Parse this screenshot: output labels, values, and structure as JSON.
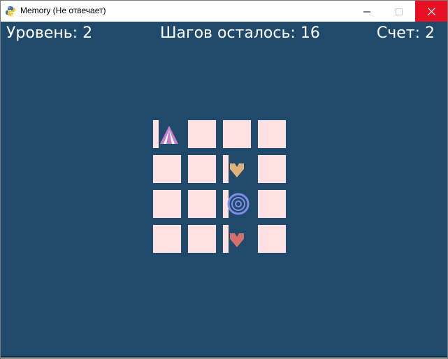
{
  "window": {
    "title": "Memory (Не отвечает)",
    "app_icon": "python-icon",
    "controls": [
      "minimize-icon",
      "maximize-icon",
      "close-icon"
    ],
    "close_color": "#e81123"
  },
  "hud": {
    "level_text": "Уровень: 2",
    "steps_text": "Шагов осталось: 16",
    "score_text": "Счет: 2"
  },
  "board": {
    "rows": 4,
    "cols": 4,
    "background_color": "#1f4a6b",
    "tile_color": "#ffe1e1",
    "revealed_tiles": [
      {
        "row": 1,
        "col": 1,
        "shape": "triangle",
        "color": "#c47fc6"
      },
      {
        "row": 2,
        "col": 3,
        "shape": "heart",
        "color": "#deb17c"
      },
      {
        "row": 3,
        "col": 3,
        "shape": "spiral",
        "color": "#7f8ee8"
      },
      {
        "row": 4,
        "col": 3,
        "shape": "heart",
        "color": "#d46f6c"
      }
    ]
  }
}
